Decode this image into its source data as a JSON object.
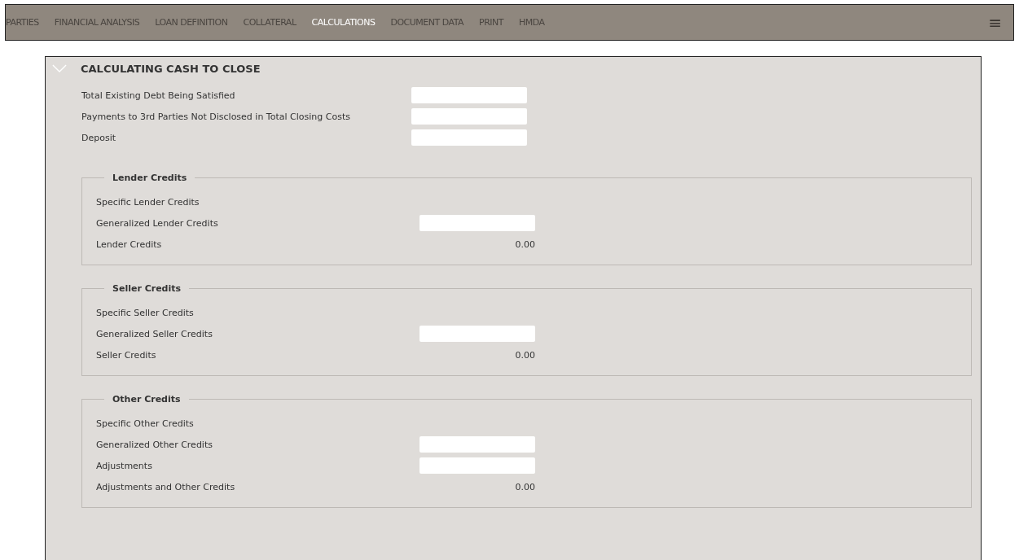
{
  "nav": {
    "tabs": [
      {
        "label": "PARTIES",
        "selected": false
      },
      {
        "label": "FINANCIAL ANALYSIS",
        "selected": false
      },
      {
        "label": "LOAN DEFINITION",
        "selected": false
      },
      {
        "label": "COLLATERAL",
        "selected": false
      },
      {
        "label": "CALCULATIONS",
        "selected": true
      },
      {
        "label": "DOCUMENT DATA",
        "selected": false
      },
      {
        "label": "PRINT",
        "selected": false
      },
      {
        "label": "HMDA",
        "selected": false
      }
    ],
    "menu_icon": "≡"
  },
  "section": {
    "title": "CALCULATING CASH TO CLOSE",
    "expanded": true,
    "rows": [
      {
        "label": "Total Existing Debt Being Satisfied",
        "kind": "field"
      },
      {
        "label": "Payments to 3rd Parties Not Disclosed in Total Closing Costs",
        "kind": "field"
      },
      {
        "label": "Deposit",
        "kind": "field"
      }
    ],
    "groups": [
      {
        "title": "Lender Credits",
        "rows": [
          {
            "label": "Specific Lender Credits",
            "kind": "label"
          },
          {
            "label": "Generalized Lender Credits",
            "kind": "field"
          },
          {
            "label": "Lender Credits",
            "kind": "value",
            "value": "0.00"
          }
        ]
      },
      {
        "title": "Seller Credits",
        "rows": [
          {
            "label": "Specific Seller Credits",
            "kind": "label"
          },
          {
            "label": "Generalized Seller Credits",
            "kind": "field"
          },
          {
            "label": "Seller Credits",
            "kind": "value",
            "value": "0.00"
          }
        ]
      },
      {
        "title": "Other Credits",
        "rows": [
          {
            "label": "Specific Other Credits",
            "kind": "label"
          },
          {
            "label": "Generalized Other Credits",
            "kind": "field"
          },
          {
            "label": "Adjustments",
            "kind": "field"
          },
          {
            "label": "Adjustments and Other Credits",
            "kind": "value",
            "value": "0.00"
          }
        ]
      }
    ]
  }
}
